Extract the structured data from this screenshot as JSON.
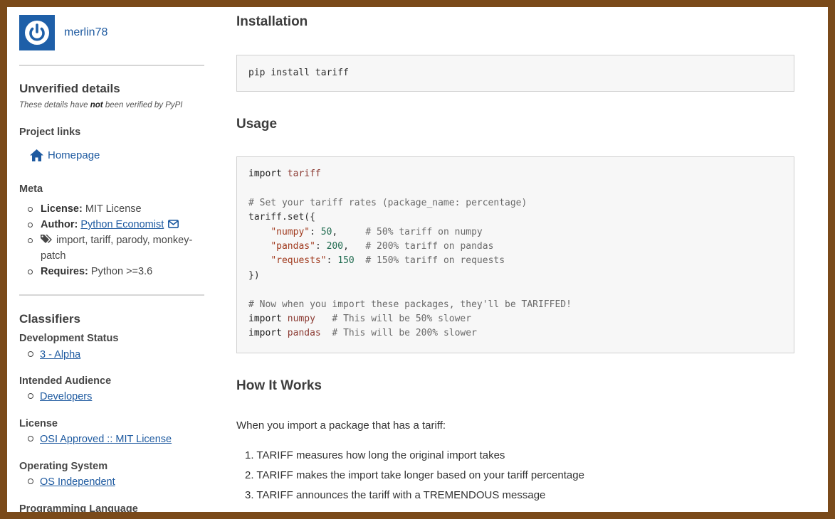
{
  "sidebar": {
    "username": "merlin78",
    "unverified_title": "Unverified details",
    "unverified_note_pre": "These details have ",
    "unverified_note_bold": "not",
    "unverified_note_post": " been verified by PyPI",
    "project_links_title": "Project links",
    "homepage_label": "Homepage",
    "meta_title": "Meta",
    "meta": {
      "license_label": "License:",
      "license_value": "MIT License",
      "author_label": "Author:",
      "author_value": "Python Economist",
      "keywords": "import, tariff, parody, monkey-patch",
      "requires_label": "Requires:",
      "requires_value": "Python >=3.6"
    },
    "classifiers_title": "Classifiers",
    "classifiers": [
      {
        "title": "Development Status",
        "value": "3 - Alpha"
      },
      {
        "title": "Intended Audience",
        "value": "Developers"
      },
      {
        "title": "License",
        "value": "OSI Approved :: MIT License"
      },
      {
        "title": "Operating System",
        "value": "OS Independent"
      },
      {
        "title": "Programming Language",
        "value": ""
      }
    ]
  },
  "main": {
    "installation_title": "Installation",
    "install_cmd": "pip install tariff",
    "usage_title": "Usage",
    "usage_code": {
      "l1_kw": "import",
      "l1_mod": "tariff",
      "l3": "# Set your tariff rates (package_name: percentage)",
      "l4": "tariff.set({",
      "l5_str": "\"numpy\"",
      "l5_num": "50",
      "l5_com": "# 50% tariff on numpy",
      "l6_str": "\"pandas\"",
      "l6_num": "200",
      "l6_com": "# 200% tariff on pandas",
      "l7_str": "\"requests\"",
      "l7_num": "150",
      "l7_com": "# 150% tariff on requests",
      "l8": "})",
      "l10": "# Now when you import these packages, they'll be TARIFFED!",
      "l11_kw": "import",
      "l11_mod": "numpy",
      "l11_com": "# This will be 50% slower",
      "l12_kw": "import",
      "l12_mod": "pandas",
      "l12_com": "# This will be 200% slower"
    },
    "how_title": "How It Works",
    "how_intro": "When you import a package that has a tariff:",
    "steps": [
      "1. TARIFF measures how long the original import takes",
      "2. TARIFF makes the import take longer based on your tariff percentage",
      "3. TARIFF announces the tariff with a TREMENDOUS message"
    ]
  }
}
